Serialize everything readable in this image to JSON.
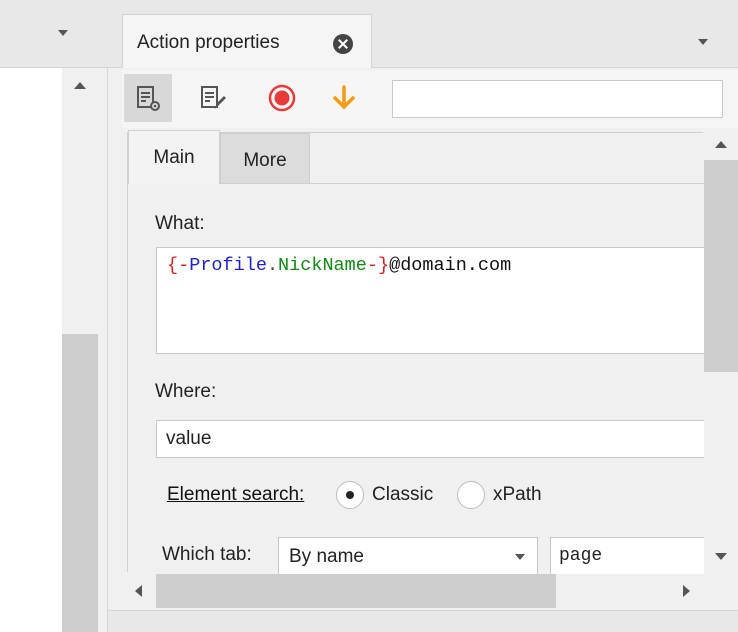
{
  "left_panel": {
    "menu_icon": "chevron-down-icon",
    "scroll_up_icon": "scroll-up-arrow-icon"
  },
  "panel": {
    "tab_title": "Action properties",
    "close_icon": "close-circle-icon",
    "menu_icon": "chevron-down-icon"
  },
  "toolbar": {
    "buttons": [
      {
        "name": "action-settings",
        "icon": "document-gear-icon",
        "active": true
      },
      {
        "name": "edit-action",
        "icon": "document-pencil-icon",
        "active": false
      },
      {
        "name": "record",
        "icon": "record-icon",
        "color": "#e83a3a"
      },
      {
        "name": "move-down",
        "icon": "arrow-down-icon",
        "color": "#f39c12"
      }
    ],
    "search_value": ""
  },
  "tabs": [
    {
      "label": "Main",
      "active": true
    },
    {
      "label": "More",
      "active": false
    }
  ],
  "form": {
    "what_label": "What:",
    "what_value_tokens": {
      "open_brace": "{-",
      "namespace": "Profile",
      "dot": ".",
      "property": "NickName",
      "close_brace": "-}",
      "suffix": "@domain.com"
    },
    "where_label": "Where:",
    "where_value": "value",
    "element_search_label": "Element search:",
    "element_search_options": [
      {
        "label": "Classic",
        "selected": true
      },
      {
        "label": "xPath",
        "selected": false
      }
    ],
    "which_tab_label": "Which tab:",
    "which_tab_value": "By name",
    "page_value": "page"
  },
  "colors": {
    "brace": "#dd1c1c",
    "namespace": "#1f1fcc",
    "property": "#118a11",
    "record": "#e83a3a",
    "arrow": "#f39c12"
  }
}
